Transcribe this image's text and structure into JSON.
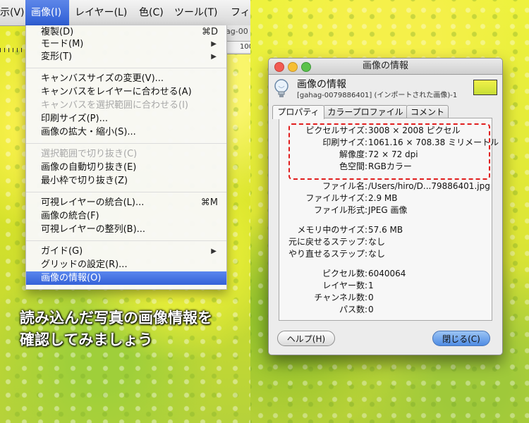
{
  "menubar": {
    "items": [
      "示(V)",
      "画像(I)",
      "レイヤー(L)",
      "色(C)",
      "ツール(T)",
      "フィ"
    ]
  },
  "image_window": {
    "tab_fragment": "ag-00",
    "ruler_fragment": "100"
  },
  "menu": {
    "groups": [
      [
        {
          "label": "複製(D)",
          "shortcut": "⌘D"
        },
        {
          "label": "モード(M)",
          "submenu": "▶"
        },
        {
          "label": "変形(T)",
          "submenu": "▶"
        }
      ],
      [
        {
          "label": "キャンバスサイズの変更(V)..."
        },
        {
          "label": "キャンバスをレイヤーに合わせる(A)"
        },
        {
          "label": "キャンバスを選択範囲に合わせる(I)",
          "disabled": true
        },
        {
          "label": "印刷サイズ(P)..."
        },
        {
          "label": "画像の拡大・縮小(S)..."
        }
      ],
      [
        {
          "label": "選択範囲で切り抜き(C)",
          "disabled": true
        },
        {
          "label": "画像の自動切り抜き(E)"
        },
        {
          "label": "最小枠で切り抜き(Z)"
        }
      ],
      [
        {
          "label": "可視レイヤーの統合(L)...",
          "shortcut": "⌘M"
        },
        {
          "label": "画像の統合(F)"
        },
        {
          "label": "可視レイヤーの整列(B)..."
        }
      ],
      [
        {
          "label": "ガイド(G)",
          "submenu": "▶"
        },
        {
          "label": "グリッドの設定(R)..."
        },
        {
          "label": "画像の情報(O)",
          "selected": true
        }
      ]
    ]
  },
  "caption": {
    "line1": "読み込んだ写真の画像情報を",
    "line2": "確認してみましょう"
  },
  "dialog": {
    "title": "画像の情報",
    "header_title": "画像の情報",
    "header_subtitle": "[gahag-0079886401] (インポートされた画像)-1",
    "tabs": [
      "プロパティ",
      "カラープロファイル",
      "コメント"
    ],
    "properties": [
      {
        "key": "ピクセルサイズ:",
        "value": "3008 × 2008 ピクセル"
      },
      {
        "key": "印刷サイズ:",
        "value": "1061.16 × 708.38 ミリメートル"
      },
      {
        "key": "解像度:",
        "value": "72 × 72 dpi"
      },
      {
        "key": "色空間:",
        "value": "RGBカラー"
      },
      {
        "key": "ファイル名:",
        "value": "/Users/hiro/D...79886401.jpg"
      },
      {
        "key": "ファイルサイズ:",
        "value": "2.9 MB"
      },
      {
        "key": "ファイル形式:",
        "value": "JPEG 画像"
      },
      {
        "key": "メモリ中のサイズ:",
        "value": "57.6 MB"
      },
      {
        "key": "元に戻せるステップ:",
        "value": "なし"
      },
      {
        "key": "やり直せるステップ:",
        "value": "なし"
      },
      {
        "key": "ピクセル数:",
        "value": "6040064"
      },
      {
        "key": "レイヤー数:",
        "value": "1"
      },
      {
        "key": "チャンネル数:",
        "value": "0"
      },
      {
        "key": "パス数:",
        "value": "0"
      }
    ],
    "help_button": "ヘルプ(H)",
    "close_button": "閉じる(C)"
  },
  "colors": {
    "highlight_box": "#e11d1d",
    "menu_selection": "#3461d8",
    "traffic_red": "#f25b52",
    "traffic_yellow": "#f6bf33",
    "traffic_green": "#5bc24a"
  }
}
